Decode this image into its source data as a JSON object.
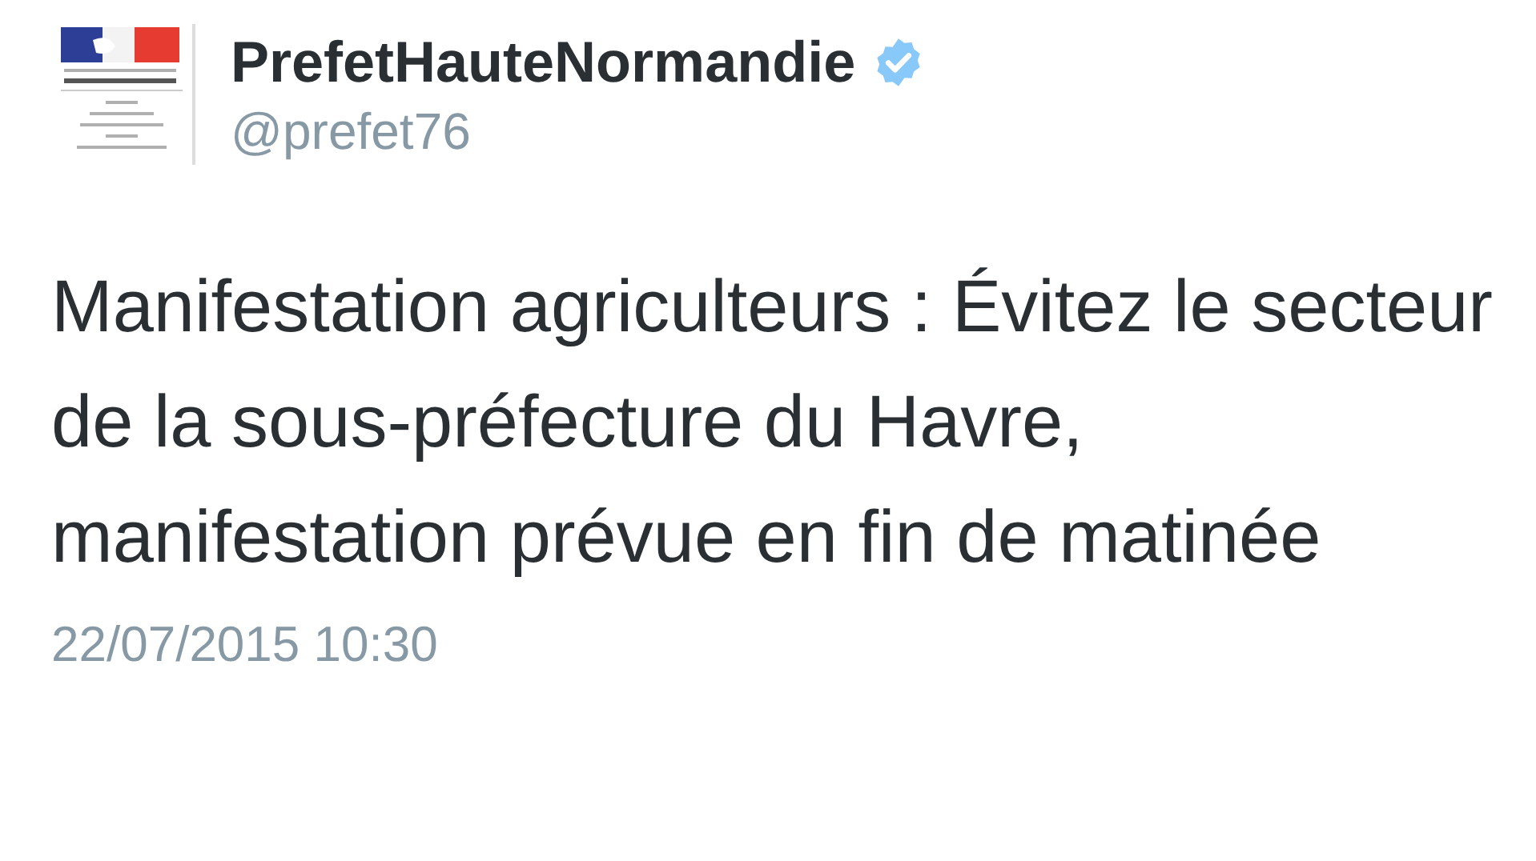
{
  "author": {
    "name": "PrefetHauteNormandie",
    "verified": true,
    "handle": "@prefet76"
  },
  "tweet": {
    "text": "Manifestation agriculteurs : Évitez le secteur de la sous-préfecture du Havre, manifestation prévue en fin de matinée",
    "timestamp": "22/07/2015 10:30"
  }
}
